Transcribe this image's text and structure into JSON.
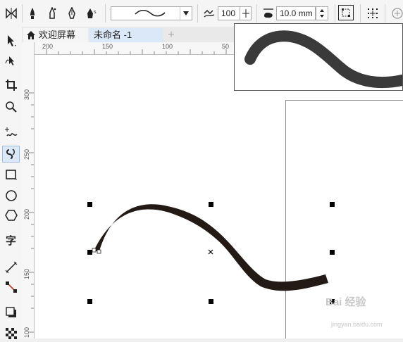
{
  "propbar": {
    "smoothing_value": "100",
    "stroke_width_value": "10.0 mm"
  },
  "tabs": {
    "welcome_label": "欢迎屏幕",
    "doc_label": "未命名 -1",
    "add_label": "+"
  },
  "hruler": {
    "labels": [
      "200",
      "150",
      "100",
      "50"
    ]
  },
  "vruler": {
    "labels": [
      "300",
      "250",
      "200",
      "150",
      "100"
    ]
  },
  "watermark": {
    "text": "Bai 经验",
    "sub": "jingyan.baidu.com"
  },
  "colors": {
    "stroke": "#231a16",
    "preview_stroke": "#3a3a3a",
    "accent": "#dbe8f7"
  },
  "icons": [
    "mirror-icon",
    "freehand-brush-icon",
    "preset-brush-icon",
    "calligraphic-pen-icon",
    "pressure-pen-icon",
    "smoothing-icon",
    "stroke-width-icon",
    "bounding-box-icon",
    "snap-icon",
    "home-icon"
  ]
}
